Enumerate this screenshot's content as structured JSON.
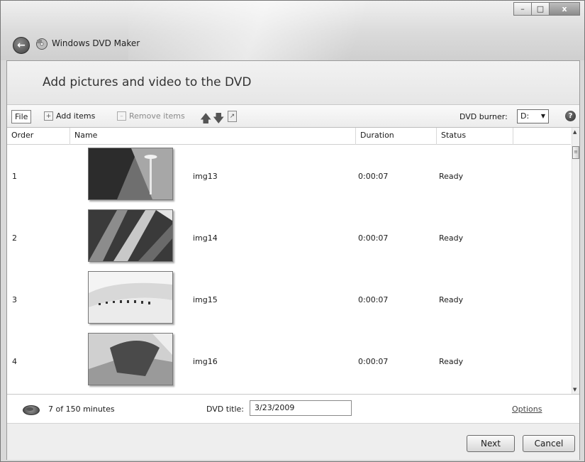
{
  "window": {
    "title": "Windows DVD Maker",
    "controls": {
      "minimize": "–",
      "maximize": "□",
      "close": "x"
    },
    "back_icon": "back-arrow-icon"
  },
  "header": {
    "title": "Add pictures and video to the DVD"
  },
  "toolbar": {
    "file_label": "File",
    "add_items_label": "Add items",
    "remove_items_label": "Remove items",
    "move_up_icon": "arrow-up-icon",
    "move_down_icon": "arrow-down-icon",
    "export_icon": "export-icon",
    "dvd_burner_label": "DVD burner:",
    "dvd_burner_value": "D:",
    "help_icon": "help-icon"
  },
  "columns": {
    "order": "Order",
    "name": "Name",
    "duration": "Duration",
    "status": "Status",
    "extra": ""
  },
  "rows": [
    {
      "order": "1",
      "name": "img13",
      "duration": "0:00:07",
      "status": "Ready"
    },
    {
      "order": "2",
      "name": "img14",
      "duration": "0:00:07",
      "status": "Ready"
    },
    {
      "order": "3",
      "name": "img15",
      "duration": "0:00:07",
      "status": "Ready"
    },
    {
      "order": "4",
      "name": "img16",
      "duration": "0:00:07",
      "status": "Ready"
    }
  ],
  "footer": {
    "minutes": "7 of 150 minutes",
    "dvd_title_label": "DVD title:",
    "dvd_title_value": "3/23/2009",
    "options_label": "Options",
    "next_label": "Next",
    "cancel_label": "Cancel"
  },
  "colors": {
    "chrome": "#d9d9d9",
    "content": "#ffffff",
    "text": "#1a1a1a"
  }
}
